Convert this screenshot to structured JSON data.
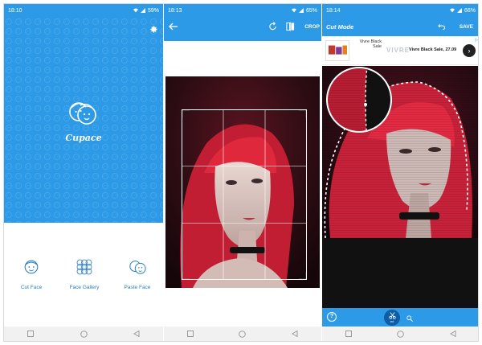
{
  "screens": [
    {
      "status": {
        "time": "18:10",
        "battery": "59%"
      },
      "brand": "Cupace",
      "actions": [
        {
          "label": "Cut Face",
          "icon": "cut-face-icon"
        },
        {
          "label": "Face Gallery",
          "icon": "face-gallery-icon"
        },
        {
          "label": "Paste Face",
          "icon": "paste-face-icon"
        }
      ]
    },
    {
      "status": {
        "time": "18:13",
        "battery": "65%"
      },
      "toolbar": {
        "crop_label": "CROP"
      }
    },
    {
      "status": {
        "time": "18:14",
        "battery": "66%"
      },
      "toolbar": {
        "title": "Cut Mode",
        "save_label": "SAVE"
      },
      "ad": {
        "text": "Vivre Black Sale",
        "brand": "VIVRE",
        "headline": "Vivre Black Sale, 27.09"
      },
      "bottom": {
        "cut_label": "cut",
        "zoom_label": "zoom",
        "help": "?"
      }
    }
  ],
  "colors": {
    "primary": "#2d9ae7",
    "primary_dark": "#0d5ea6",
    "hair": "#d8263a"
  }
}
